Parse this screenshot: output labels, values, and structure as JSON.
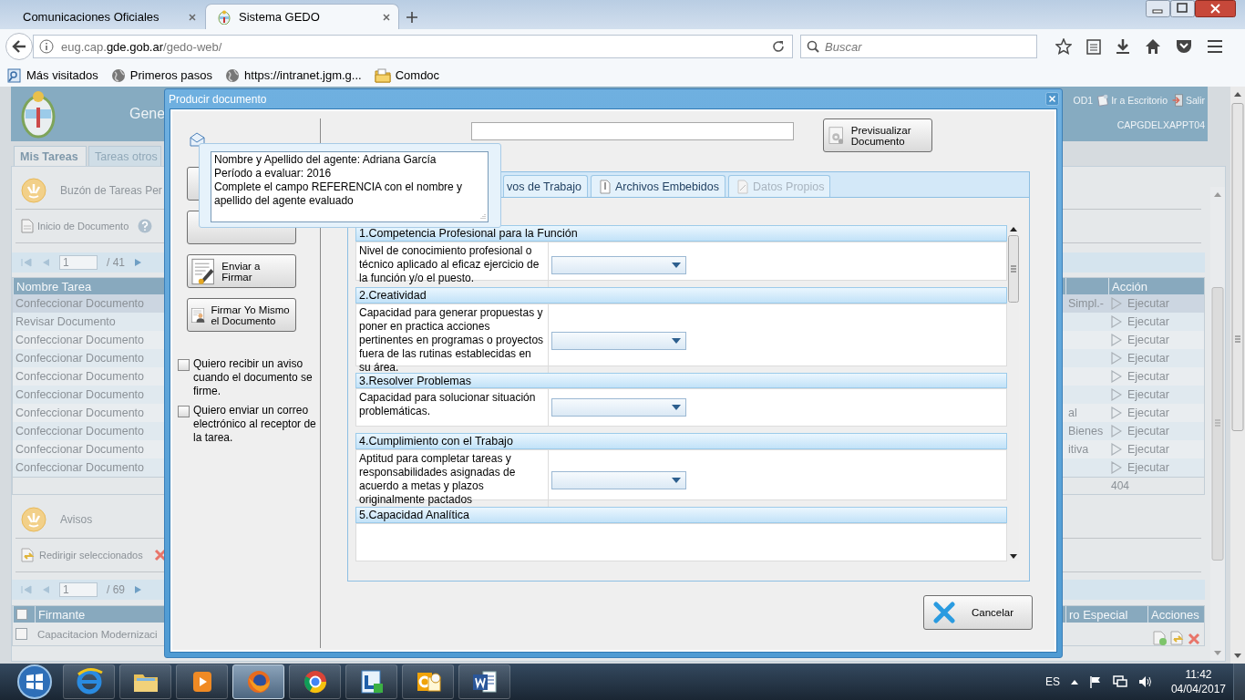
{
  "browser": {
    "tabs": [
      {
        "label": "Comunicaciones Oficiales",
        "selected": false,
        "kind": "plain"
      },
      {
        "label": "Sistema GEDO",
        "selected": true,
        "kind": "emblem"
      }
    ],
    "address": {
      "prefix": "eug.cap.",
      "domain": "gde.gob.ar",
      "path": "/gedo-web/"
    },
    "search": {
      "placeholder": "Buscar"
    },
    "bookmarks": [
      {
        "label": "Más visitados",
        "kind": "frequent"
      },
      {
        "label": "Primeros pasos",
        "kind": "globe"
      },
      {
        "label": "https://intranet.jgm.g...",
        "kind": "globe"
      },
      {
        "label": "Comdoc",
        "kind": "folder"
      }
    ]
  },
  "app": {
    "title": "Gene",
    "user": "OD1",
    "links": [
      {
        "label": "Ir a Escritorio",
        "kind": "desktop"
      },
      {
        "label": "Salir",
        "kind": "exit"
      }
    ],
    "station": "CAPGDELXAPPT04",
    "tabs": [
      {
        "label": "Mis Tareas",
        "selected": true
      },
      {
        "label": "Tareas otros",
        "selected": false
      }
    ],
    "inbox": {
      "title": "Buzón de Tareas Per",
      "start_link": "Inicio de Documento",
      "pager": {
        "page": "1",
        "total": "/ 41"
      },
      "columns": [
        "Nombre Tarea",
        "Acción"
      ],
      "rows": [
        {
          "task": "Confeccionar Documento",
          "note": "Simpl.-",
          "action": "Ejecutar",
          "selected": true
        },
        {
          "task": "Revisar Documento",
          "action": "Ejecutar",
          "selected": false
        },
        {
          "task": "Confeccionar Documento",
          "action": "Ejecutar",
          "selected": false
        },
        {
          "task": "Confeccionar Documento",
          "action": "Ejecutar",
          "selected": false
        },
        {
          "task": "Confeccionar Documento",
          "action": "Ejecutar",
          "selected": false
        },
        {
          "task": "Confeccionar Documento",
          "action": "Ejecutar",
          "selected": false
        },
        {
          "task": "Confeccionar Documento",
          "note": "al",
          "action": "Ejecutar",
          "selected": false
        },
        {
          "task": "Confeccionar Documento",
          "note": "Bienes",
          "action": "Ejecutar",
          "selected": false
        },
        {
          "task": "Confeccionar Documento",
          "note": "itiva",
          "action": "Ejecutar",
          "selected": false
        },
        {
          "task": "Confeccionar Documento",
          "action": "Ejecutar",
          "selected": false
        }
      ],
      "total": "404"
    },
    "notices": {
      "title": "Avisos",
      "redirect": "Redirigir seleccionados",
      "pager": {
        "page": "1",
        "total": "/ 69"
      },
      "select_all": {
        "checked": false
      },
      "columns": [
        "Firmante",
        "ro Especial",
        "Acciones"
      ],
      "rows": [
        {
          "signer": "Capacitacion Modernizaci",
          "checked": false
        }
      ]
    }
  },
  "dialog": {
    "title": "Producir documento",
    "note": "Nombre y Apellido del agente: Adriana García\nPeríodo a evaluar: 2016\nComplete el campo REFERENCIA con el nombre y\napellido del agente evaluado",
    "actions": [
      {
        "kind": "covered"
      },
      {
        "kind": "covered"
      },
      {
        "kind": "send",
        "label": "Enviar a Firmar"
      },
      {
        "kind": "self",
        "label": "Firmar Yo Mismo el Documento"
      }
    ],
    "options": [
      {
        "label": "Quiero recibir un aviso cuando el documento se firme.",
        "checked": false
      },
      {
        "label": "Quiero enviar un correo electrónico al receptor de la tarea.",
        "checked": false
      }
    ],
    "preview": "Previsualizar Documento",
    "tabs": [
      {
        "label": "vos de Trabajo",
        "selected": false,
        "disabled": false,
        "kind": "plain"
      },
      {
        "label": "Archivos Embebidos",
        "selected": false,
        "disabled": false,
        "kind": "clip"
      },
      {
        "label": "Datos Propios",
        "selected": false,
        "disabled": true,
        "kind": "data"
      }
    ],
    "sections": [
      {
        "title": "1.Competencia Profesional para la Función",
        "description": "Nivel de conocimiento profesional o técnico aplicado al eficaz ejercicio de la función y/o el puesto."
      },
      {
        "title": "2.Creatividad",
        "description": "Capacidad para generar propuestas y poner en practica acciones pertinentes en programas o proyectos fuera de las rutinas establecidas en su área."
      },
      {
        "title": "3.Resolver Problemas",
        "description": "Capacidad para solucionar situación problemáticas."
      },
      {
        "title": "4.Cumplimiento con el Trabajo",
        "description": "Aptitud para completar tareas y responsabilidades asignadas de acuerdo a metas y plazos originalmente pactados"
      },
      {
        "title": "5.Capacidad Analítica"
      }
    ],
    "cancel": "Cancelar"
  },
  "taskbar": {
    "apps": [
      {
        "kind": "ie",
        "active": false
      },
      {
        "kind": "explorer",
        "active": false
      },
      {
        "kind": "media",
        "active": false
      },
      {
        "kind": "firefox",
        "active": true
      },
      {
        "kind": "chrome",
        "active": false
      },
      {
        "kind": "lync",
        "active": false
      },
      {
        "kind": "outlook",
        "active": false
      },
      {
        "kind": "word",
        "active": false
      }
    ],
    "language": "ES",
    "time": "11:42",
    "date": "04/04/2017"
  }
}
